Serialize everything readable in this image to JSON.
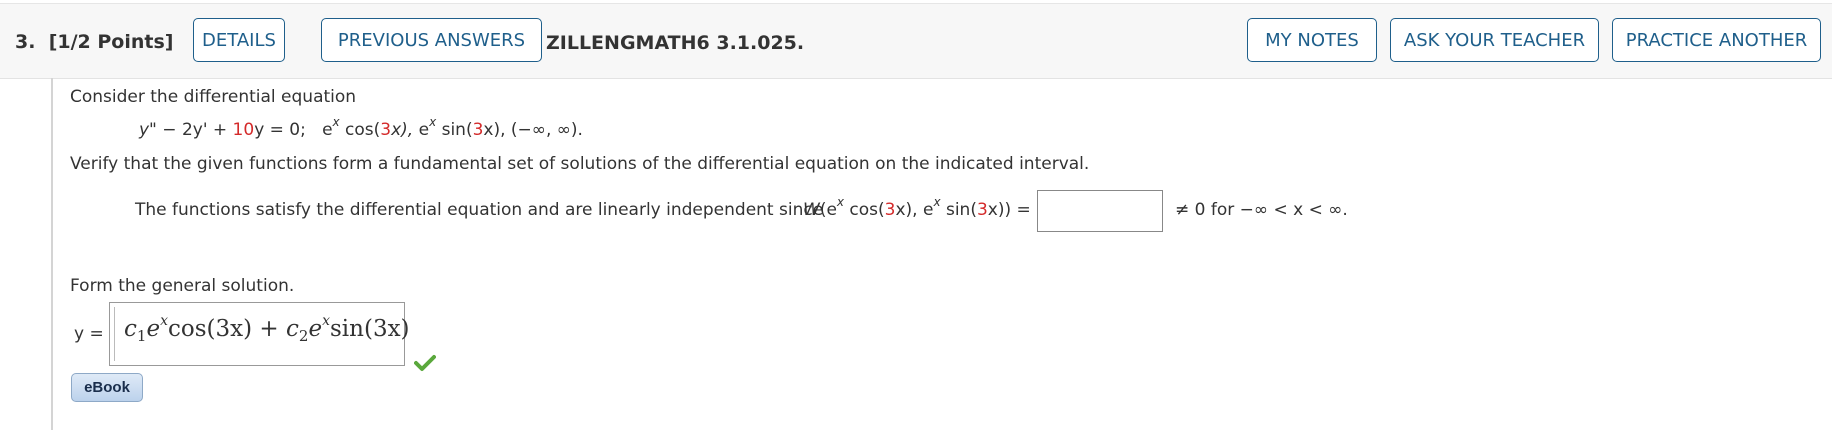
{
  "header": {
    "question_number": "3.",
    "points": "[1/2 Points]",
    "details_label": "DETAILS",
    "previous_answers_label": "PREVIOUS ANSWERS",
    "assignment_id": "ZILLENGMATH6 3.1.025.",
    "my_notes_label": "MY NOTES",
    "ask_teacher_label": "ASK YOUR TEACHER",
    "practice_another_label": "PRACTICE ANOTHER"
  },
  "problem": {
    "intro": "Consider the differential equation",
    "equation": {
      "lhs_y2": "y\"",
      "minus_2y": " − 2y' + ",
      "coef": "10",
      "y_eq_zero": "y = 0;",
      "f1_pre": "e",
      "exp": "x",
      "f1_post_cos": " cos(",
      "three": "3",
      "xclose": "x), ",
      "f2_post_sin": " sin(",
      "interval": "x), (−∞, ∞)."
    },
    "verify_text": "Verify that the given functions form a fundamental set of solutions of the differential equation on the indicated interval.",
    "wronskian": {
      "lead": "The functions satisfy the differential equation and are linearly independent since",
      "W": "W",
      "open": "(e",
      "cos_part": " cos(",
      "three": "3",
      "x_close_comma": "x), e",
      "sin_part": " sin(",
      "x_close_close": "x)) =",
      "input_value": "",
      "tail": "≠ 0  for  −∞ < x < ∞."
    },
    "general_prompt": "Form the general solution.",
    "y_label": "y =",
    "answer": {
      "c": "c",
      "one": "1",
      "two": "2",
      "e": "e",
      "x": "x",
      "cos": "cos",
      "sin": "sin",
      "arg": "3x",
      "plus": "+"
    }
  },
  "ebook_label": "eBook",
  "colors": {
    "accent": "#1f5f8b",
    "highlight_red": "#d42a2a",
    "check_green": "#5aa83c"
  },
  "icons": {
    "correct": "check-icon"
  }
}
